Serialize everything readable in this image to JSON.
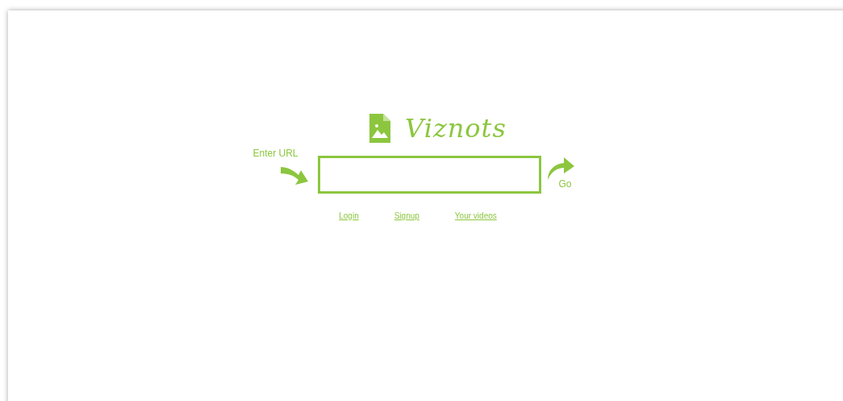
{
  "logo": {
    "name": "Viznots"
  },
  "url_field": {
    "label": "Enter URL"
  },
  "go_button": {
    "label": "Go"
  },
  "links": [
    {
      "label": "Login"
    },
    {
      "label": "Signup"
    },
    {
      "label": "Your videos"
    }
  ]
}
